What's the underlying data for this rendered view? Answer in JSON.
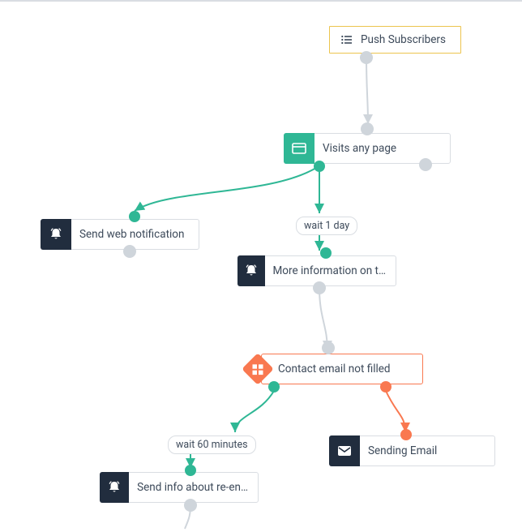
{
  "push": {
    "label": "Push Subscribers"
  },
  "visits": {
    "label": "Visits any page"
  },
  "wait1": {
    "label": "wait 1 day"
  },
  "sendweb": {
    "label": "Send web notification"
  },
  "moreinfo": {
    "label": "More information on t…"
  },
  "condition": {
    "label": "Contact email not filled"
  },
  "wait60": {
    "label": "wait 60 minutes"
  },
  "sendemail": {
    "label": "Sending Email"
  },
  "sendre": {
    "label": "Send info about re-en…"
  },
  "colors": {
    "green": "#2fb795",
    "red": "#f97850",
    "gray": "#cfd5db",
    "dark": "#212d3e",
    "yellow": "#ecc44e"
  }
}
